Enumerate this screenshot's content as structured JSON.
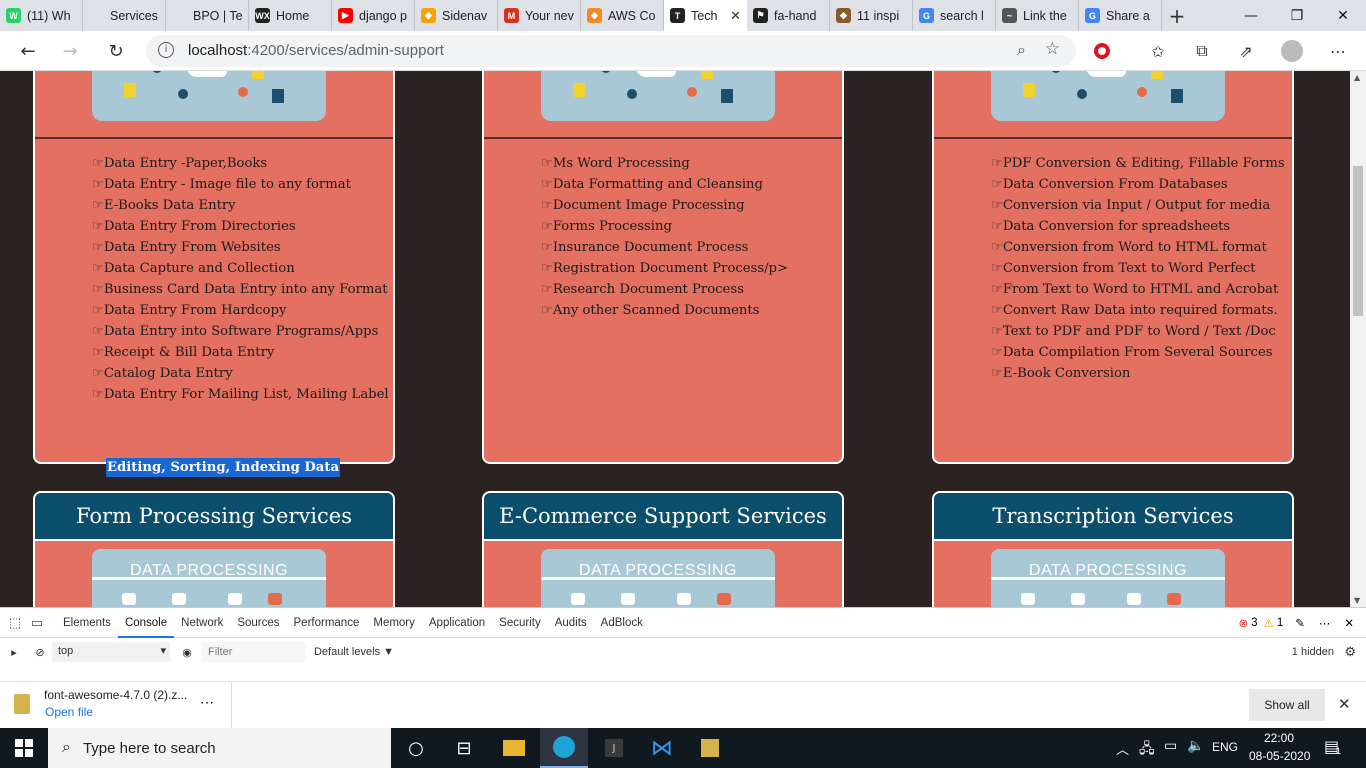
{
  "browser": {
    "tabs": [
      {
        "label": "(11) Wh",
        "fav_color": "#25d366",
        "fav_text": "W"
      },
      {
        "label": "Services",
        "fav_color": "#dee1e6",
        "fav_text": ""
      },
      {
        "label": "BPO | Te",
        "fav_color": "#dee1e6",
        "fav_text": ""
      },
      {
        "label": "Home",
        "fav_color": "#222222",
        "fav_text": "WX"
      },
      {
        "label": "django p",
        "fav_color": "#ff0000",
        "fav_text": "▶"
      },
      {
        "label": "Sidenav",
        "fav_color": "#f4a300",
        "fav_text": "◆"
      },
      {
        "label": "Your nev",
        "fav_color": "#d93025",
        "fav_text": "M"
      },
      {
        "label": "AWS Co",
        "fav_color": "#f08a24",
        "fav_text": "◆"
      },
      {
        "label": "Tech",
        "fav_color": "#222222",
        "fav_text": "T"
      },
      {
        "label": "fa-hand",
        "fav_color": "#222222",
        "fav_text": "⚑"
      },
      {
        "label": "11 inspi",
        "fav_color": "#8a5a2b",
        "fav_text": "◆"
      },
      {
        "label": "search l",
        "fav_color": "#4285f4",
        "fav_text": "G"
      },
      {
        "label": "Link the",
        "fav_color": "#555555",
        "fav_text": "~"
      },
      {
        "label": "Share a",
        "fav_color": "#4285f4",
        "fav_text": "G"
      }
    ],
    "active_tab_index": 8,
    "url_host": "localhost",
    "url_path": ":4200/services/admin-support"
  },
  "page": {
    "cards_top": [
      {
        "items": [
          "☞Data Entry -Paper,Books",
          "☞Data Entry - Image file to any format",
          "☞E-Books Data Entry",
          "☞Data Entry From Directories",
          "☞Data Entry From Websites",
          "☞Data Capture and Collection",
          "☞Business Card Data Entry into any Format",
          "☞Data Entry From Hardcopy",
          "☞Data Entry into Software Programs/Apps",
          "☞Receipt & Bill Data Entry",
          "☞Catalog Data Entry",
          "☞Data Entry For Mailing List, Mailing Label"
        ],
        "overflow_selected": "Editing, Sorting, Indexing Data"
      },
      {
        "items": [
          "☞Ms Word Processing",
          "☞Data Formatting and Cleansing",
          "☞Document Image Processing",
          "☞Forms Processing",
          "☞Insurance Document Process",
          "☞Registration Document Process/p>",
          "☞Research Document Process",
          "☞Any other Scanned Documents"
        ]
      },
      {
        "items": [
          "☞PDF Conversion & Editing, Fillable Forms",
          "☞Data Conversion From Databases",
          "☞Conversion via Input / Output for media",
          "☞Data Conversion for spreadsheets",
          "☞Conversion from Word to HTML format",
          "☞Conversion from Text to Word Perfect",
          "☞From Text to Word to HTML and Acrobat",
          "☞Convert Raw Data into required formats.",
          "☞Text to PDF and PDF to Word / Text /Doc",
          "☞Data Compilation From Several Sources",
          "☞E-Book Conversion"
        ]
      }
    ],
    "cards_bottom": [
      {
        "title": "Form Processing Services",
        "image_label": "DATA PROCESSING"
      },
      {
        "title": "E-Commerce Support Services",
        "image_label": "DATA PROCESSING"
      },
      {
        "title": "Transcription Services",
        "image_label": "DATA PROCESSING"
      }
    ],
    "colors": {
      "card_bg": "#e37060",
      "header_bg": "#0b4f6c",
      "page_bg": "#2b2222"
    }
  },
  "devtools": {
    "tabs": [
      "Elements",
      "Console",
      "Network",
      "Sources",
      "Performance",
      "Memory",
      "Application",
      "Security",
      "Audits",
      "AdBlock"
    ],
    "active": "Console",
    "errors": "3",
    "warnings": "1",
    "context": "top",
    "filter_placeholder": "Filter",
    "levels": "Default levels ▼",
    "hidden": "1 hidden"
  },
  "download": {
    "filename": "font-awesome-4.7.0 (2).z...",
    "action": "Open file",
    "show_all": "Show all"
  },
  "taskbar": {
    "search_placeholder": "Type here to search",
    "lang": "ENG",
    "time": "22:00",
    "date": "08-05-2020",
    "notifications": "1"
  }
}
